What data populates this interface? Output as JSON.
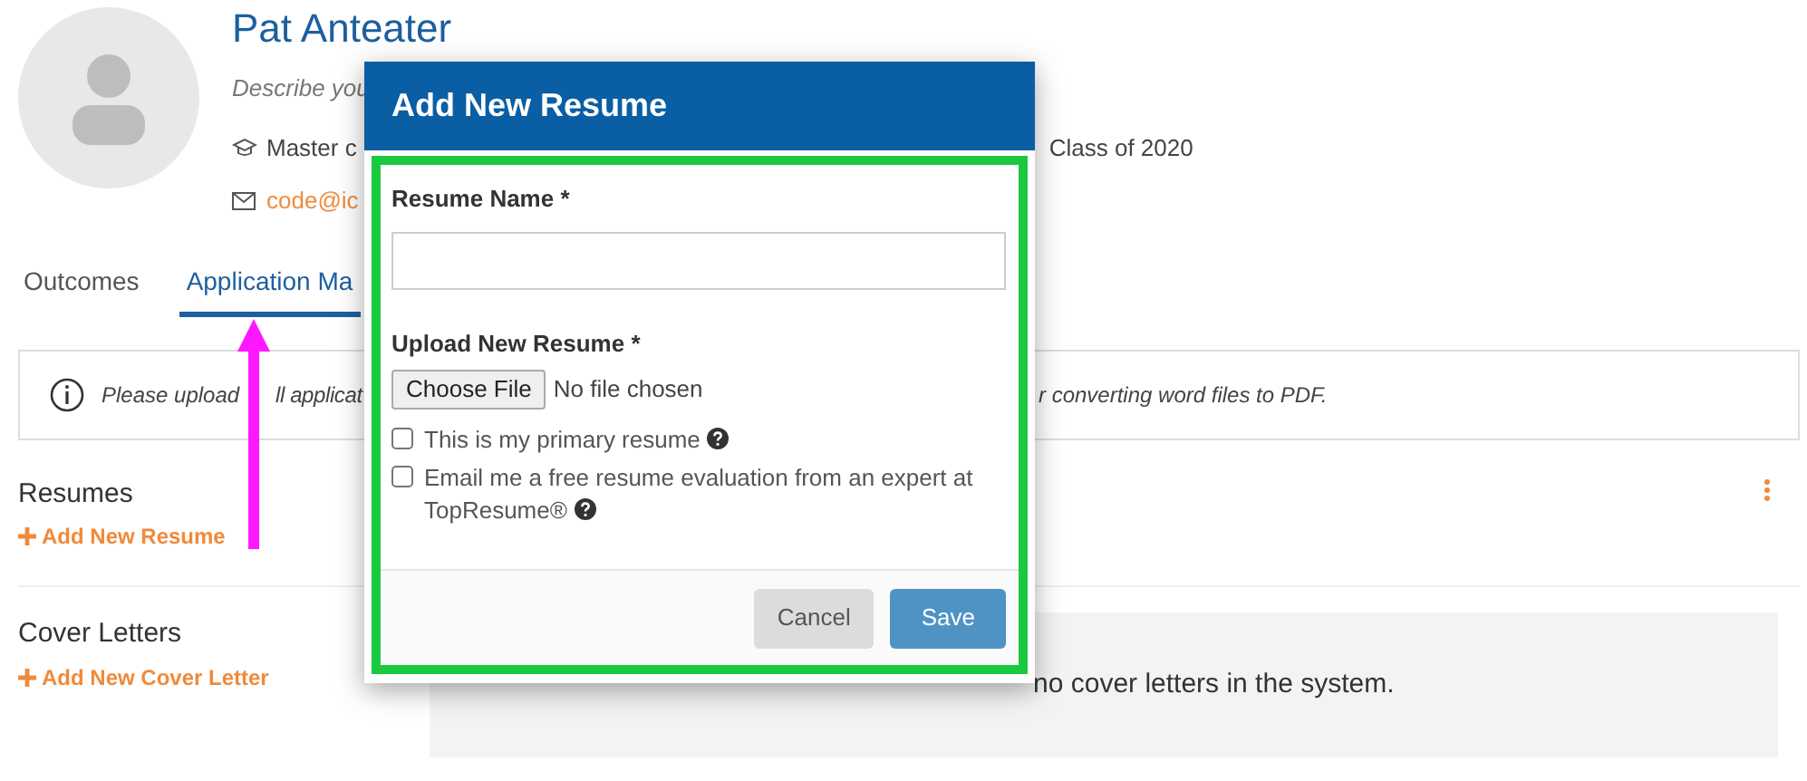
{
  "profile": {
    "name": "Pat Anteater",
    "description": "Describe you",
    "degree": "Master c",
    "class_year": "Class of 2020",
    "email": "code@ic"
  },
  "tabs": [
    {
      "label": "Outcomes",
      "selected": false
    },
    {
      "label": "Application Ma",
      "selected": true
    }
  ],
  "notice": {
    "text_before_arrow": "Please upload",
    "text_after_arrow": "ll applicat",
    "text_right": "r converting word files to PDF."
  },
  "resumes": {
    "title": "Resumes",
    "add_link": "Add New Resume"
  },
  "cover_letters": {
    "title": "Cover Letters",
    "add_link": "Add New Cover Letter",
    "empty_message": "no cover letters in the system."
  },
  "modal": {
    "title": "Add New Resume",
    "name_label": "Resume Name *",
    "upload_label": "Upload New Resume *",
    "file_button": "Choose File",
    "file_status": "No file chosen",
    "checkboxes": [
      {
        "label": "This is my primary resume",
        "checked": false
      },
      {
        "label": "Email me a free resume evaluation from an expert at TopResume®",
        "checked": false
      }
    ],
    "buttons": [
      {
        "label": "Cancel",
        "kind": "secondary"
      },
      {
        "label": "Save",
        "kind": "primary"
      }
    ]
  }
}
